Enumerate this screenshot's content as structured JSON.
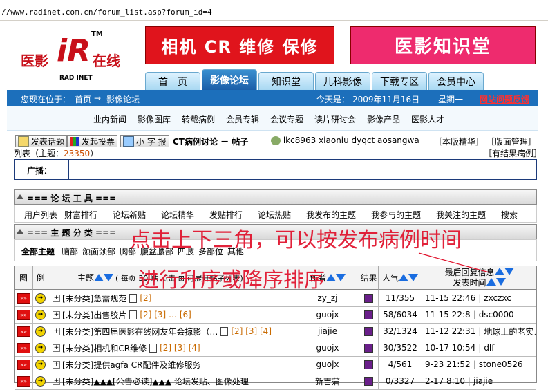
{
  "browser": {
    "url": "//www.radinet.com.cn/forum_list.asp?forum_id=4"
  },
  "logo": {
    "cn_left": "医影",
    "cn_right": "在线",
    "en": "RAD INET",
    "tm": "TM",
    "mark": "iR"
  },
  "banners": {
    "left": "相机 CR 维修 保修",
    "right": "医影知识堂"
  },
  "nav_tabs": [
    {
      "label": "首　页"
    },
    {
      "label": "影像论坛"
    },
    {
      "label": "知识堂"
    },
    {
      "label": "儿科影像"
    },
    {
      "label": "下载专区"
    },
    {
      "label": "会员中心"
    }
  ],
  "location": {
    "prefix": "您现在位于：",
    "home": "首页",
    "arrow": "→",
    "current": "影像论坛",
    "today_label": "今天是：",
    "date": "2009年11月16日",
    "weekday": "星期一",
    "feedback": "网站问题反馈"
  },
  "subnav": [
    "业内新闻",
    "影像图库",
    "转载病例",
    "会员专辑",
    "会议专题",
    "读片研讨会",
    "影像产品",
    "医影人才"
  ],
  "toolbar": {
    "post_topic": "发表话题",
    "post_poll": "发起投票",
    "small_font": "小 字 报",
    "forum_title": "CT病例讨论 － 帖子",
    "moderators": "lkc8963 xiaoniu dyqct aosangwa",
    "essence": "［本版精华］",
    "admin": "［版面管理］",
    "list_prefix": "列表（主题：",
    "count": "23350",
    "list_suffix": "）",
    "results": "［有结果病例］"
  },
  "broadcast": {
    "label": "广播："
  },
  "tools": {
    "title": "=== 论 坛 工 具 ===",
    "items": [
      "用户列表",
      "财富排行",
      "论坛新贴",
      "论坛精华",
      "发贴排行",
      "论坛热贴",
      "我发布的主题",
      "我参与的主题",
      "我关注的主题",
      "搜索"
    ]
  },
  "categories": {
    "title": "=== 主 题 分 类 ===",
    "items": [
      "全部主题",
      "脑部",
      "颌面颈部",
      "胸部",
      "腹盆腰部",
      "四肢",
      "多部位",
      "其他"
    ]
  },
  "annotation": {
    "line1": "点击上下三角，可以按发布病例时间",
    "line2": "进行升序或降序排序"
  },
  "table": {
    "headers": {
      "icon": "图",
      "case": "例",
      "topic": "主题",
      "topic_note": "( 每页 30 贴 点击 ⊞ 可展开贴子列表)",
      "author": "作者",
      "result": "结果",
      "views": "人气",
      "last_reply": "最后回复信息",
      "post_time": "发表时间"
    },
    "rows": [
      {
        "title": "[未分类]急需规范",
        "pages": "[2]",
        "author": "zy_zj",
        "views": "11/355",
        "last": "11-15 22:46",
        "last_user": "zxczxc"
      },
      {
        "title": "[未分类]出售胶片",
        "pages": "[2] [3] … [6]",
        "author": "guojx",
        "views": "58/6034",
        "last": "11-15 22:8",
        "last_user": "dsc0000"
      },
      {
        "title": "[未分类]第四届医影在线网友年会掠影（…",
        "pages": "[2] [3] [4]",
        "author": "jiajie",
        "views": "32/1324",
        "last": "11-12 22:31",
        "last_user": "地球上的老实人"
      },
      {
        "title": "[未分类]相机和CR维修",
        "pages": "[2] [3] [4]",
        "author": "guojx",
        "views": "30/3522",
        "last": "10-17 10:54",
        "last_user": "dlf"
      },
      {
        "title": "[未分类]提供agfa CR配件及维修服务",
        "pages": "",
        "author": "guojx",
        "views": "4/561",
        "last": "9-23 21:52",
        "last_user": "stone0526"
      },
      {
        "title": "[未分类]▲▲▲[公告必读]▲▲▲ 论坛发贴、图像处理",
        "pages": "",
        "author": "新吉蒲",
        "views": "0/3327",
        "last": "2-17 8:10",
        "last_user": "jiajie"
      }
    ]
  }
}
